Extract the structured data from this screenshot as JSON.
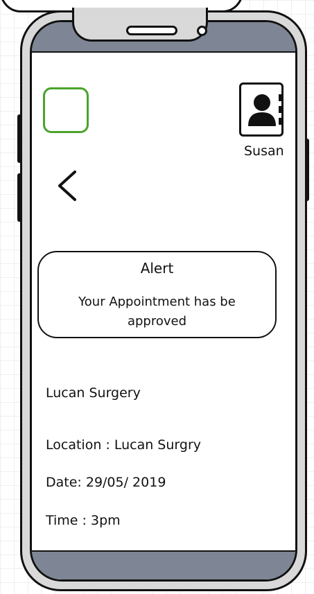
{
  "profile": {
    "name": "Susan"
  },
  "alert": {
    "title": "Alert",
    "message": "Your  Appointment has  be approved"
  },
  "appointment": {
    "surgery": "Lucan Surgery",
    "location": "Location : Lucan Surgry",
    "date": "Date: 29/05/ 2019",
    "time": "Time : 3pm"
  },
  "icons": {
    "home": "home-square-icon",
    "profile": "contact-book-person-icon",
    "back": "chevron-left-icon"
  },
  "colors": {
    "bars": "#7e8594",
    "frame": "#d9d9d9",
    "home_accent": "#4aa32a"
  }
}
